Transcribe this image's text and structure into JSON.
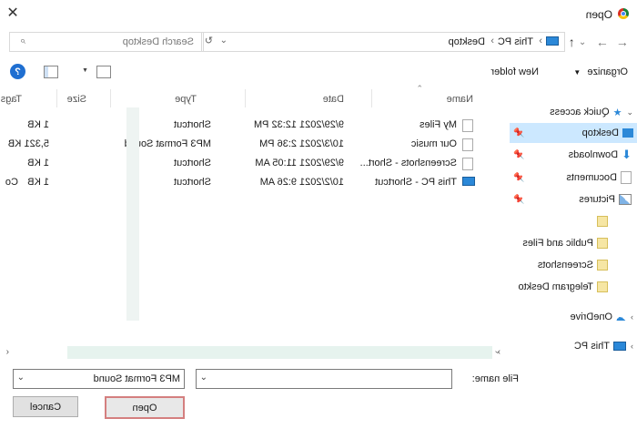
{
  "window": {
    "title": "Open"
  },
  "nav": {
    "back_label": "←",
    "forward_label": "→",
    "up_label": "↑",
    "recent_label": "⌄",
    "address": [
      "This PC",
      "Desktop"
    ],
    "refresh_label": "↻",
    "search_placeholder": "Search Desktop"
  },
  "toolbar": {
    "organize": "Organize",
    "new_folder": "New folder"
  },
  "columns": {
    "name": "Name",
    "date": "Date",
    "type": "Type",
    "size": "Size",
    "tags": "Tags"
  },
  "files": [
    {
      "name": "My Files",
      "date": "9/29/2021 12:32 PM",
      "type": "Shortcut",
      "size": "1 KB",
      "tags": ""
    },
    {
      "name": "Our music",
      "date": "10/3/2021 2:36 PM",
      "type": "MP3 Format Sound",
      "size": "5,321 KB",
      "tags": ""
    },
    {
      "name": "Screenshots - Short...",
      "date": "9/29/2021 11:05 AM",
      "type": "Shortcut",
      "size": "1 KB",
      "tags": ""
    },
    {
      "name": "This PC - Shortcut",
      "date": "10/2/2021 9:26 AM",
      "type": "Shortcut",
      "size": "1 KB",
      "tags": "Co"
    }
  ],
  "sidebar": {
    "quick_access": "Quick access",
    "items": [
      {
        "label": "Desktop"
      },
      {
        "label": "Downloads"
      },
      {
        "label": "Documents"
      },
      {
        "label": "Pictures"
      },
      {
        "label": ""
      },
      {
        "label": "Public and Files"
      },
      {
        "label": "Screenshots"
      },
      {
        "label": "Telegram Deskto"
      }
    ],
    "onedrive": "OneDrive",
    "this_pc": "This PC"
  },
  "bottom": {
    "file_name_label": "File name:",
    "file_name_value": "",
    "filter_value": "MP3 Format Sound",
    "open": "Open",
    "cancel": "Cancel"
  }
}
